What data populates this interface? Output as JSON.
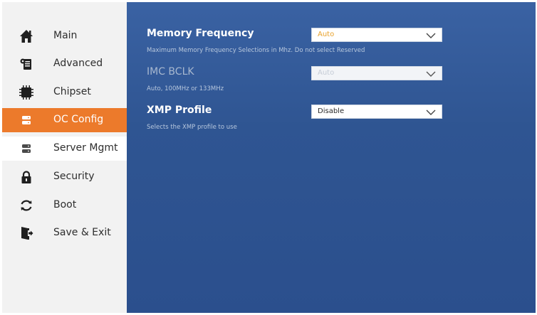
{
  "sidebar": {
    "items": [
      {
        "label": "Main",
        "icon": "home-icon"
      },
      {
        "label": "Advanced",
        "icon": "advanced-icon"
      },
      {
        "label": "Chipset",
        "icon": "chip-icon"
      },
      {
        "label": "OC Config",
        "icon": "server-icon"
      },
      {
        "label": "Server Mgmt",
        "icon": "server-icon"
      },
      {
        "label": "Security",
        "icon": "lock-icon"
      },
      {
        "label": "Boot",
        "icon": "refresh-icon"
      },
      {
        "label": "Save & Exit",
        "icon": "exit-door-icon"
      }
    ],
    "active_item": "OC Config"
  },
  "settings": {
    "memory_frequency": {
      "title": "Memory Frequency",
      "description": "Maximum Memory Frequency Selections in Mhz. Do not select Reserved",
      "value": "Auto"
    },
    "imc_bclk": {
      "title": "IMC BCLK",
      "description": "Auto, 100MHz or 133MHz",
      "value": "Auto"
    },
    "xmp_profile": {
      "title": "XMP Profile",
      "description": "Selects the XMP profile to use",
      "value": "Disable"
    }
  },
  "colors": {
    "accent": "#ec7a2b",
    "content_bg": "#2f5490",
    "selected_value": "#e8a22c"
  }
}
